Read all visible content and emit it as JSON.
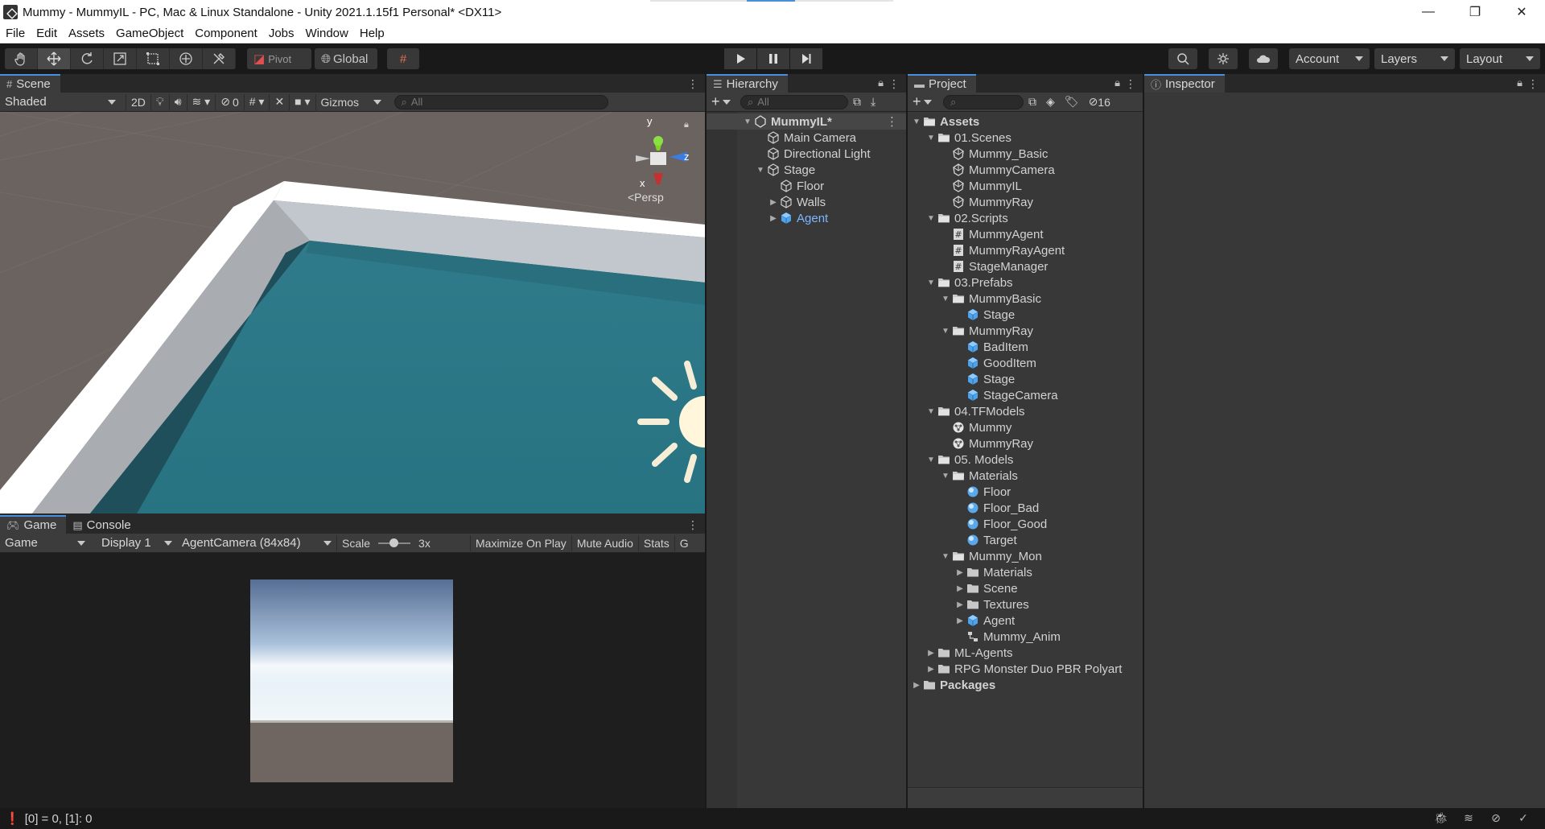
{
  "window": {
    "title": "Mummy - MummyIL - PC, Mac & Linux Standalone - Unity 2021.1.15f1 Personal* <DX11>",
    "controls": [
      "—",
      "❐",
      "✕"
    ]
  },
  "menu": [
    "File",
    "Edit",
    "Assets",
    "GameObject",
    "Component",
    "Jobs",
    "Window",
    "Help"
  ],
  "toolbar": {
    "pivot_label": "Pivot",
    "global_label": "Global",
    "account_label": "Account",
    "layers_label": "Layers",
    "layout_label": "Layout"
  },
  "scene": {
    "tab_label": "Scene",
    "shading": "Shaded",
    "mode_2d": "2D",
    "hidden_count": "0",
    "gizmos_label": "Gizmos",
    "search_placeholder": "All",
    "gizmo_y": "y",
    "gizmo_z": "z",
    "gizmo_x": "x",
    "persp_label": "<Persp"
  },
  "game": {
    "tab_game": "Game",
    "tab_console": "Console",
    "view_mode": "Game",
    "display": "Display 1",
    "resolution": "AgentCamera (84x84)",
    "scale_label": "Scale",
    "scale_value": "3x",
    "maximize": "Maximize On Play",
    "mute": "Mute Audio",
    "stats": "Stats",
    "gizmos_cut": "G"
  },
  "hierarchy": {
    "tab_label": "Hierarchy",
    "search_placeholder": "All",
    "scene_name": "MummyIL*",
    "items": [
      {
        "label": "Main Camera",
        "depth": 1,
        "arrow": "",
        "icon": "gameobject-icon",
        "color": "#d2d2d2"
      },
      {
        "label": "Directional Light",
        "depth": 1,
        "arrow": "",
        "icon": "gameobject-icon",
        "color": "#d2d2d2"
      },
      {
        "label": "Stage",
        "depth": 1,
        "arrow": "▼",
        "icon": "gameobject-icon",
        "color": "#d2d2d2"
      },
      {
        "label": "Floor",
        "depth": 2,
        "arrow": "",
        "icon": "gameobject-icon",
        "color": "#d2d2d2"
      },
      {
        "label": "Walls",
        "depth": 2,
        "arrow": "▶",
        "icon": "gameobject-icon",
        "color": "#d2d2d2"
      },
      {
        "label": "Agent",
        "depth": 2,
        "arrow": "▶",
        "icon": "prefab-icon",
        "color": "#7cb6ff"
      }
    ]
  },
  "project": {
    "tab_label": "Project",
    "hidden_count": "16",
    "items": [
      {
        "label": "Assets",
        "depth": 0,
        "arrow": "▼",
        "icon": "folder-open-icon",
        "bold": true
      },
      {
        "label": "01.Scenes",
        "depth": 1,
        "arrow": "▼",
        "icon": "folder-open-icon"
      },
      {
        "label": "Mummy_Basic",
        "depth": 2,
        "arrow": "",
        "icon": "scene-icon"
      },
      {
        "label": "MummyCamera",
        "depth": 2,
        "arrow": "",
        "icon": "scene-icon"
      },
      {
        "label": "MummyIL",
        "depth": 2,
        "arrow": "",
        "icon": "scene-icon"
      },
      {
        "label": "MummyRay",
        "depth": 2,
        "arrow": "",
        "icon": "scene-icon"
      },
      {
        "label": "02.Scripts",
        "depth": 1,
        "arrow": "▼",
        "icon": "folder-open-icon"
      },
      {
        "label": "MummyAgent",
        "depth": 2,
        "arrow": "",
        "icon": "script-icon"
      },
      {
        "label": "MummyRayAgent",
        "depth": 2,
        "arrow": "",
        "icon": "script-icon"
      },
      {
        "label": "StageManager",
        "depth": 2,
        "arrow": "",
        "icon": "script-icon"
      },
      {
        "label": "03.Prefabs",
        "depth": 1,
        "arrow": "▼",
        "icon": "folder-open-icon"
      },
      {
        "label": "MummyBasic",
        "depth": 2,
        "arrow": "▼",
        "icon": "folder-open-icon"
      },
      {
        "label": "Stage",
        "depth": 3,
        "arrow": "",
        "icon": "prefab-icon"
      },
      {
        "label": "MummyRay",
        "depth": 2,
        "arrow": "▼",
        "icon": "folder-open-icon"
      },
      {
        "label": "BadItem",
        "depth": 3,
        "arrow": "",
        "icon": "prefab-icon"
      },
      {
        "label": "GoodItem",
        "depth": 3,
        "arrow": "",
        "icon": "prefab-icon"
      },
      {
        "label": "Stage",
        "depth": 3,
        "arrow": "",
        "icon": "prefab-icon"
      },
      {
        "label": "StageCamera",
        "depth": 3,
        "arrow": "",
        "icon": "prefab-icon"
      },
      {
        "label": "04.TFModels",
        "depth": 1,
        "arrow": "▼",
        "icon": "folder-open-icon"
      },
      {
        "label": "Mummy",
        "depth": 2,
        "arrow": "",
        "icon": "nnmodel-icon"
      },
      {
        "label": "MummyRay",
        "depth": 2,
        "arrow": "",
        "icon": "nnmodel-icon"
      },
      {
        "label": "05. Models",
        "depth": 1,
        "arrow": "▼",
        "icon": "folder-open-icon"
      },
      {
        "label": "Materials",
        "depth": 2,
        "arrow": "▼",
        "icon": "folder-open-icon"
      },
      {
        "label": "Floor",
        "depth": 3,
        "arrow": "",
        "icon": "material-icon"
      },
      {
        "label": "Floor_Bad",
        "depth": 3,
        "arrow": "",
        "icon": "material-icon"
      },
      {
        "label": "Floor_Good",
        "depth": 3,
        "arrow": "",
        "icon": "material-icon"
      },
      {
        "label": "Target",
        "depth": 3,
        "arrow": "",
        "icon": "material-icon"
      },
      {
        "label": "Mummy_Mon",
        "depth": 2,
        "arrow": "▼",
        "icon": "folder-open-icon"
      },
      {
        "label": "Materials",
        "depth": 3,
        "arrow": "▶",
        "icon": "folder-icon"
      },
      {
        "label": "Scene",
        "depth": 3,
        "arrow": "▶",
        "icon": "folder-icon"
      },
      {
        "label": "Textures",
        "depth": 3,
        "arrow": "▶",
        "icon": "folder-icon"
      },
      {
        "label": "Agent",
        "depth": 3,
        "arrow": "▶",
        "icon": "prefab-icon"
      },
      {
        "label": "Mummy_Anim",
        "depth": 3,
        "arrow": "",
        "icon": "animator-icon"
      },
      {
        "label": "ML-Agents",
        "depth": 1,
        "arrow": "▶",
        "icon": "folder-icon"
      },
      {
        "label": "RPG Monster Duo PBR Polyart",
        "depth": 1,
        "arrow": "▶",
        "icon": "folder-icon"
      },
      {
        "label": "Packages",
        "depth": 0,
        "arrow": "▶",
        "icon": "folder-icon",
        "bold": true
      }
    ]
  },
  "inspector": {
    "tab_label": "Inspector"
  },
  "status": {
    "message": "[0] = 0, [1]: 0"
  }
}
